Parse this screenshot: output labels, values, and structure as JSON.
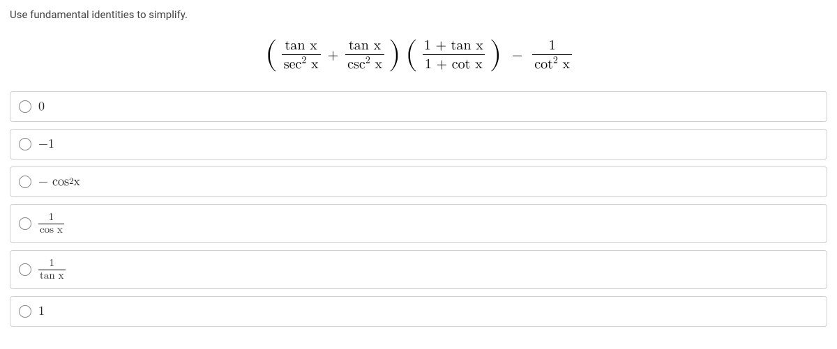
{
  "prompt": "Use fundamental identities to simplify.",
  "equation": {
    "t1_num": "tan x",
    "t1_den_a": "sec",
    "t1_den_b": " x",
    "plus": "+",
    "t2_num": "tan x",
    "t2_den_a": "csc",
    "t2_den_b": " x",
    "t3_num": "1 + tan x",
    "t3_den": "1 + cot x",
    "minus": "−",
    "t4_num": "1",
    "t4_den_a": "cot",
    "t4_den_b": " x"
  },
  "options": {
    "a": "0",
    "b": "−1",
    "c_pre": "− cos",
    "c_post": " x",
    "d_num": "1",
    "d_den": "cos x",
    "e_num": "1",
    "e_den": "tan x",
    "f": "1"
  }
}
